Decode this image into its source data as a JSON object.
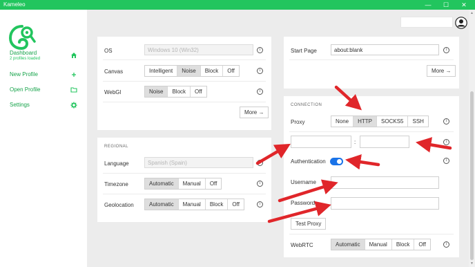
{
  "window": {
    "title": "Kameleo",
    "minimize": "—",
    "maximize": "☐",
    "close": "✕"
  },
  "sidebar": {
    "items": [
      {
        "label": "Dashboard",
        "sub": "2 profiles loaded",
        "icon": "home-icon"
      },
      {
        "label": "New Profile",
        "icon": "plus-icon"
      },
      {
        "label": "Open Profile",
        "icon": "folder-icon"
      },
      {
        "label": "Settings",
        "icon": "gear-icon"
      }
    ]
  },
  "colors": {
    "accent": "#22c55e",
    "toggle": "#1a73e8",
    "arrow": "#e0262a"
  },
  "left_top_card": {
    "os": {
      "label": "OS",
      "value": "Windows 10 (Win32)"
    },
    "canvas": {
      "label": "Canvas",
      "options": [
        "Intelligent",
        "Noise",
        "Block",
        "Off"
      ],
      "selected": "Noise"
    },
    "webgl": {
      "label": "WebGl",
      "options": [
        "Noise",
        "Block",
        "Off"
      ],
      "selected": "Noise"
    },
    "more": "More",
    "info": "i"
  },
  "regional": {
    "title": "REGIONAL",
    "language": {
      "label": "Language",
      "value": "Spanish (Spain)"
    },
    "timezone": {
      "label": "Timezone",
      "options": [
        "Automatic",
        "Manual",
        "Off"
      ],
      "selected": "Automatic"
    },
    "geolocation": {
      "label": "Geolocation",
      "options": [
        "Automatic",
        "Manual",
        "Block",
        "Off"
      ],
      "selected": "Automatic"
    }
  },
  "right_top_card": {
    "start_page": {
      "label": "Start Page",
      "value": "about:blank"
    },
    "more": "More"
  },
  "connection": {
    "title": "CONNECTION",
    "proxy": {
      "label": "Proxy",
      "options": [
        "None",
        "HTTP",
        "SOCKS5",
        "SSH"
      ],
      "selected": "HTTP"
    },
    "host_value": "",
    "port_value": "",
    "separator": ":",
    "authentication": {
      "label": "Authentication",
      "enabled": true
    },
    "username": {
      "label": "Username",
      "value": ""
    },
    "password": {
      "label": "Password",
      "value": ""
    },
    "test_proxy": "Test Proxy",
    "webrtc": {
      "label": "WebRTC",
      "options": [
        "Automatic",
        "Manual",
        "Block",
        "Off"
      ],
      "selected": "Automatic"
    }
  }
}
